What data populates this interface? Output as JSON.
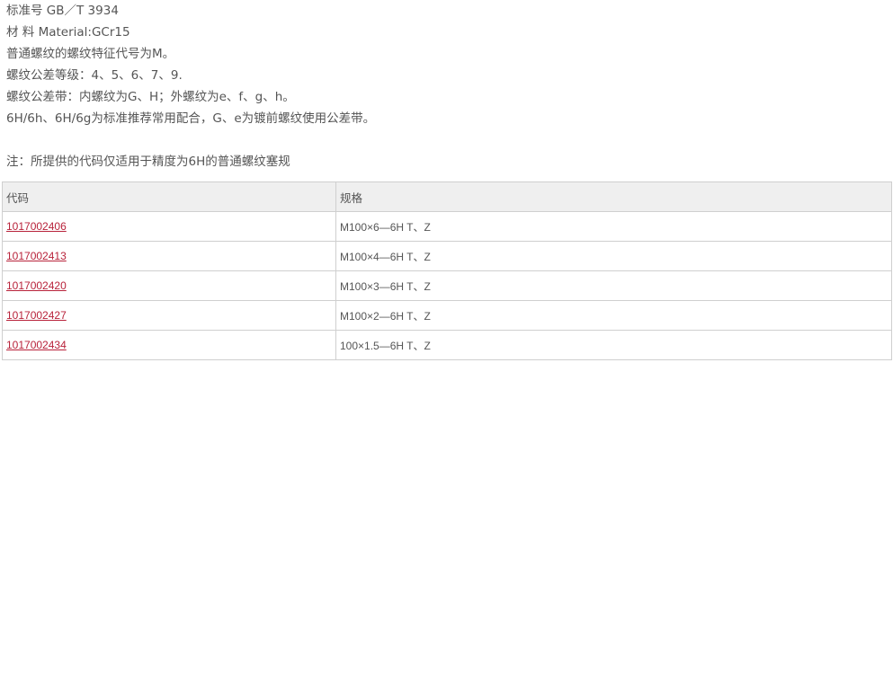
{
  "info": {
    "standard": "标准号 GB／T 3934",
    "material": "材 料 Material:GCr15",
    "thread_code": "普通螺纹的螺纹特征代号为M。",
    "tolerance_grade": "螺纹公差等级：4、5、6、7、9.",
    "tolerance_zone": "螺纹公差带：内螺纹为G、H；外螺纹为e、f、g、h。",
    "fit": "6H/6h、6H/6g为标准推荐常用配合，G、e为镀前螺纹使用公差带。",
    "note": "注：所提供的代码仅适用于精度为6H的普通螺纹塞规"
  },
  "table": {
    "headers": {
      "code": "代码",
      "spec": "规格"
    },
    "rows": [
      {
        "code": "1017002406",
        "spec": "M100×6—6H T、Z"
      },
      {
        "code": "1017002413",
        "spec": "M100×4—6H T、Z"
      },
      {
        "code": "1017002420",
        "spec": "M100×3—6H T、Z"
      },
      {
        "code": "1017002427",
        "spec": "M100×2—6H T、Z"
      },
      {
        "code": "1017002434",
        "spec": "100×1.5—6H T、Z"
      }
    ]
  },
  "colors": {
    "text": "#555555",
    "link": "#b8223a",
    "header_bg": "#efefef",
    "border": "#cfcfcf"
  }
}
